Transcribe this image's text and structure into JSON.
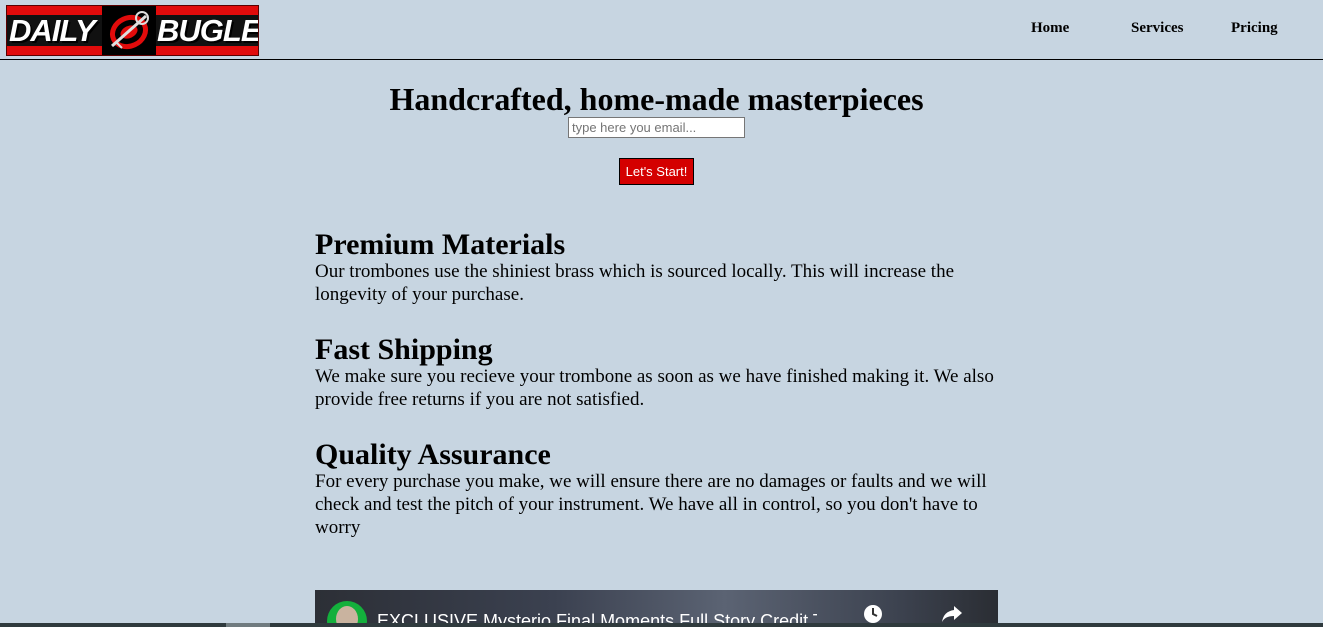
{
  "logo": {
    "left_text": "DAILY",
    "right_text": "BUGLE",
    "emblem": "trombone-emblem-icon"
  },
  "nav": {
    "home": "Home",
    "services": "Services",
    "pricing": "Pricing"
  },
  "hero": {
    "title": "Handcrafted, home-made masterpieces",
    "email_placeholder": "type here you email...",
    "start_button": "Let's Start!"
  },
  "features": [
    {
      "title": "Premium Materials",
      "text": "Our trombones use the shiniest brass which is sourced locally. This will increase the longevity of your purchase."
    },
    {
      "title": "Fast Shipping",
      "text": "We make sure you recieve your trombone as soon as we have finished making it. We also provide free returns if you are not satisfied."
    },
    {
      "title": "Quality Assurance",
      "text": "For every purchase you make, we will ensure there are no damages or faults and we will check and test the pitch of your instrument. We have all in control, so you don't have to worry"
    }
  ],
  "video": {
    "title": "EXCLUSIVE Mysterio Final Moments Full Story Credit T...",
    "icons": [
      "watch-later-icon",
      "share-icon"
    ]
  },
  "colors": {
    "background": "#c7d5e1",
    "button": "#d40000",
    "logo_red": "#e10b0b"
  }
}
